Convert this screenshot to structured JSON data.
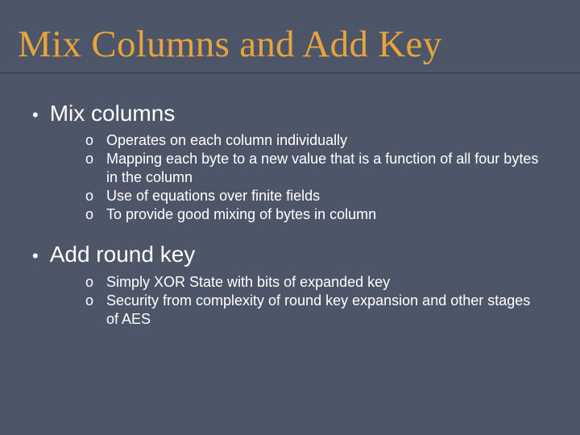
{
  "title": "Mix Columns and Add Key",
  "sections": [
    {
      "heading": "Mix columns",
      "items": [
        "Operates on each column individually",
        "Mapping each byte to a new value that is a function of all four bytes in the column",
        "Use of equations over finite fields",
        "To provide good mixing of bytes in column"
      ]
    },
    {
      "heading": "Add round key",
      "items": [
        "Simply XOR State with bits of expanded key",
        "Security from complexity of round key expansion and other stages of AES"
      ]
    }
  ],
  "markers": {
    "bullet": "•",
    "sub": "o"
  }
}
